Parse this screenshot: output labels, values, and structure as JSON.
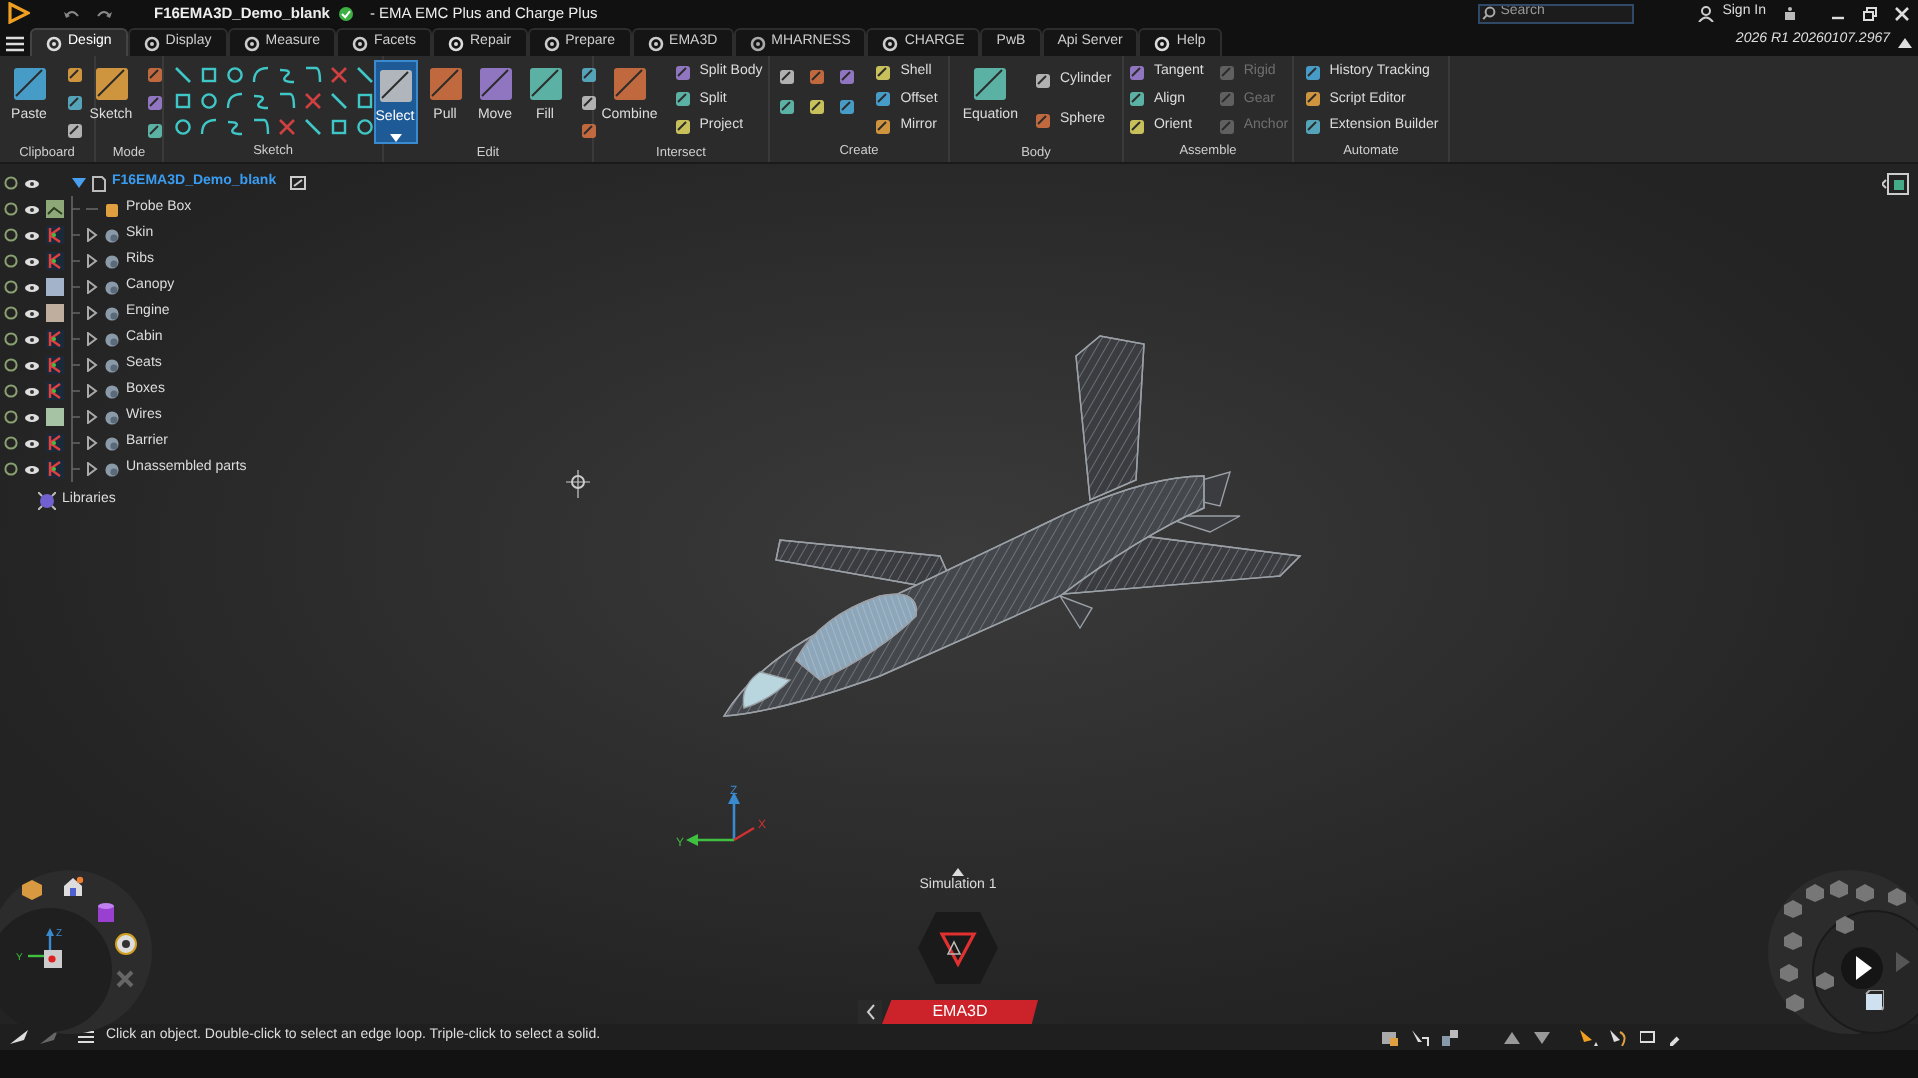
{
  "title_bar": {
    "document": "F16EMA3D_Demo_blank",
    "app_title": "- EMA EMC Plus and Charge Plus",
    "search": {
      "placeholder": "Search"
    },
    "sign_in": "Sign In"
  },
  "tabs": [
    {
      "label": "Design",
      "selected": true,
      "icon": true
    },
    {
      "label": "Display",
      "selected": false,
      "icon": true
    },
    {
      "label": "Measure",
      "selected": false,
      "icon": true
    },
    {
      "label": "Facets",
      "selected": false,
      "icon": true
    },
    {
      "label": "Repair",
      "selected": false,
      "icon": true
    },
    {
      "label": "Prepare",
      "selected": false,
      "icon": true
    },
    {
      "label": "EMA3D",
      "selected": false,
      "icon": true
    },
    {
      "label": "MHARNESS",
      "selected": false,
      "icon": true
    },
    {
      "label": "CHARGE",
      "selected": false,
      "icon": true
    },
    {
      "label": "PwB",
      "selected": false,
      "icon": false
    },
    {
      "label": "Api Server",
      "selected": false,
      "icon": false
    },
    {
      "label": "Help",
      "selected": false,
      "icon": true
    }
  ],
  "version": "2026 R1 20260107.2967",
  "ribbon": [
    {
      "kind": "clipboard",
      "label": "Clipboard",
      "items": [
        {
          "label": "Paste",
          "kind": "large",
          "disabled": false,
          "selected": false
        }
      ]
    },
    {
      "kind": "mode",
      "label": "Mode",
      "items": [
        {
          "label": "Sketch",
          "kind": "large",
          "disabled": false,
          "selected": false
        }
      ]
    },
    {
      "kind": "sketch",
      "label": "Sketch"
    },
    {
      "kind": "edit",
      "label": "Edit",
      "items": [
        {
          "label": "Select",
          "kind": "large",
          "disabled": false,
          "selected": true
        },
        {
          "label": "Pull",
          "kind": "large",
          "disabled": false,
          "selected": false
        },
        {
          "label": "Move",
          "kind": "large",
          "disabled": false,
          "selected": false
        },
        {
          "label": "Fill",
          "kind": "large",
          "disabled": false,
          "selected": false
        }
      ]
    },
    {
      "kind": "intersect",
      "label": "Intersect",
      "items": [
        {
          "label": "Combine",
          "kind": "large",
          "disabled": false,
          "selected": false
        },
        {
          "label": "Split Body",
          "kind": "small",
          "disabled": false,
          "selected": false
        },
        {
          "label": "Split",
          "kind": "small",
          "disabled": false,
          "selected": false
        },
        {
          "label": "Project",
          "kind": "small",
          "disabled": false,
          "selected": false
        }
      ]
    },
    {
      "kind": "create",
      "label": "Create",
      "items": [
        {
          "label": "Shell",
          "kind": "small",
          "disabled": false,
          "selected": false
        },
        {
          "label": "Offset",
          "kind": "small",
          "disabled": false,
          "selected": false
        },
        {
          "label": "Mirror",
          "kind": "small",
          "disabled": false,
          "selected": false
        }
      ]
    },
    {
      "kind": "body",
      "label": "Body",
      "items": [
        {
          "label": "Equation",
          "kind": "large",
          "disabled": false,
          "selected": false
        },
        {
          "label": "Cylinder",
          "kind": "small",
          "disabled": false,
          "selected": false
        },
        {
          "label": "Sphere",
          "kind": "small",
          "disabled": false,
          "selected": false
        }
      ]
    },
    {
      "kind": "assemble",
      "label": "Assemble",
      "items": [
        {
          "label": "Tangent",
          "kind": "small",
          "disabled": false,
          "selected": false
        },
        {
          "label": "Align",
          "kind": "small",
          "disabled": false,
          "selected": false
        },
        {
          "label": "Orient",
          "kind": "small",
          "disabled": false,
          "selected": false
        },
        {
          "label": "Rigid",
          "kind": "small",
          "disabled": true,
          "selected": false
        },
        {
          "label": "Gear",
          "kind": "small",
          "disabled": true,
          "selected": false
        },
        {
          "label": "Anchor",
          "kind": "small",
          "disabled": true,
          "selected": false
        }
      ]
    },
    {
      "kind": "automate",
      "label": "Automate",
      "items": [
        {
          "label": "History Tracking",
          "kind": "small",
          "disabled": false,
          "selected": false
        },
        {
          "label": "Script Editor",
          "kind": "small",
          "disabled": false,
          "selected": false
        },
        {
          "label": "Extension Builder",
          "kind": "small",
          "disabled": false,
          "selected": false
        }
      ]
    }
  ],
  "tree": {
    "label": "F16EMA3D_Demo_blank",
    "expanded": true,
    "children": [
      {
        "label": "Probe Box",
        "kind": "probe"
      },
      {
        "label": "Skin",
        "kind": "mesh",
        "expanded": false
      },
      {
        "label": "Ribs",
        "kind": "mesh",
        "expanded": false
      },
      {
        "label": "Canopy",
        "kind": "color",
        "color": "#a3b3c9",
        "expanded": false
      },
      {
        "label": "Engine",
        "kind": "color",
        "color": "#bfae9e",
        "expanded": false
      },
      {
        "label": "Cabin",
        "kind": "mesh",
        "expanded": false
      },
      {
        "label": "Seats",
        "kind": "mesh",
        "expanded": false
      },
      {
        "label": "Boxes",
        "kind": "mesh",
        "expanded": false
      },
      {
        "label": "Wires",
        "kind": "color",
        "color": "#a6c4a4",
        "expanded": false
      },
      {
        "label": "Barrier",
        "kind": "mesh",
        "expanded": false
      },
      {
        "label": "Unassembled parts",
        "kind": "mesh",
        "expanded": false
      }
    ]
  },
  "libraries": "Libraries",
  "viewport": {
    "triad": {
      "x": "X",
      "y": "Y",
      "z": "Z"
    },
    "nav_triad": {
      "y": "Y",
      "z": "Z"
    },
    "simulation": "Simulation 1",
    "panel_tab": "EMA3D"
  },
  "status_bar": {
    "message": "Click an object. Double-click to select an edge loop. Triple-click to select a solid."
  }
}
